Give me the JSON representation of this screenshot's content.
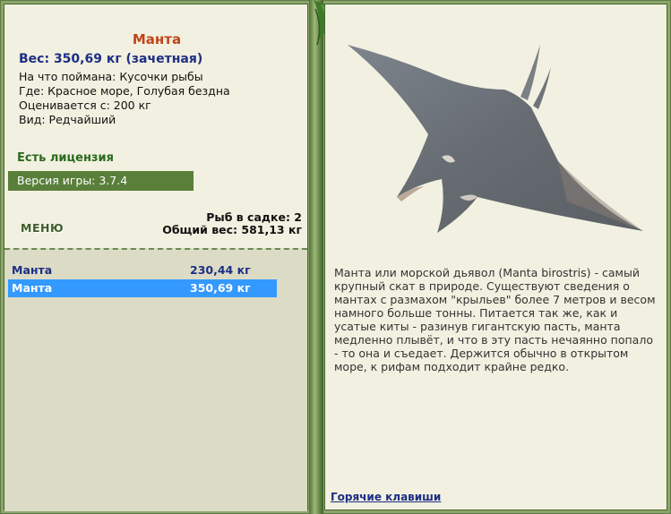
{
  "fish": {
    "name": "Манта",
    "weight": "Вес: 350,69 кг (зачетная)",
    "bait": "На что поймана: Кусочки рыбы",
    "location": "Где: Красное море, Голубая бездна",
    "value": "Оценивается с: 200 кг",
    "rarity": "Вид: Редчайший"
  },
  "license": "Есть лицензия",
  "version": "Версия игры: 3.7.4",
  "menu_label": "МЕНЮ",
  "stats": {
    "count": "Рыб в садке: 2",
    "total": "Общий вес: 581,13 кг"
  },
  "catch_list": [
    {
      "name": "Манта",
      "weight": "230,44 кг"
    },
    {
      "name": "Манта",
      "weight": "350,69 кг"
    }
  ],
  "description": "Манта или морской дьявол (Manta birostris) - самый крупный скат в природе. Существуют сведения о мантах с размахом \"крыльев\" более 7 метров и весом намного больше тонны. Питается так же, как и усатые киты - разинув гигантскую пасть, манта медленно плывёт, и что в эту пасть нечаянно попало - то она и съедает. Держится обычно в открытом море, к рифам подходит крайне редко.",
  "hotkeys": "Горячие клавиши",
  "colors": {
    "title": "#c0441a",
    "accent": "#1d2e84",
    "panel": "#f2f0e0",
    "selection": "#3399ff",
    "green": "#597f3a"
  }
}
